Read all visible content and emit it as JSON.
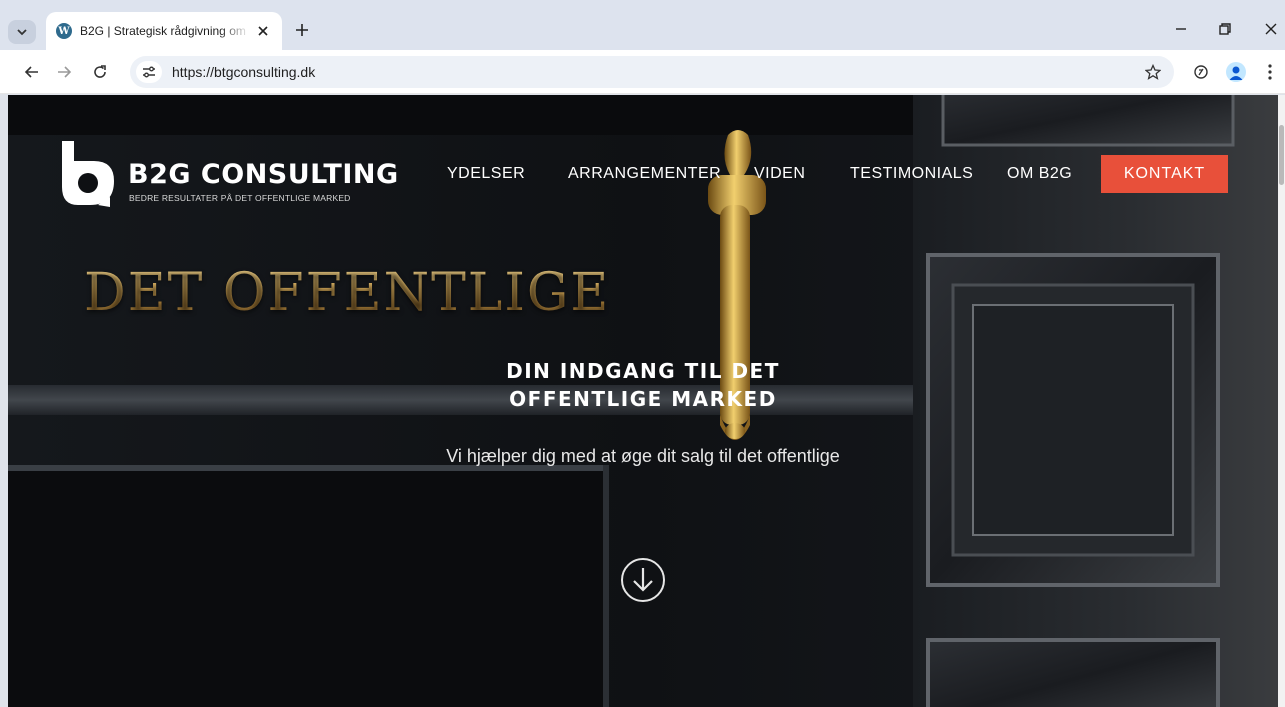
{
  "browser": {
    "tab": {
      "title": "B2G | Strategisk rådgivning om",
      "favicon": "wordpress-icon"
    },
    "address": {
      "url": "https://btgconsulting.dk"
    }
  },
  "site": {
    "logo": {
      "name": "B2G CONSULTING",
      "tagline": "BEDRE RESULTATER PÅ DET OFFENTLIGE MARKED"
    },
    "nav": [
      {
        "label": "YDELSER"
      },
      {
        "label": "ARRANGEMENTER"
      },
      {
        "label": "VIDEN"
      },
      {
        "label": "TESTIMONIALS"
      },
      {
        "label": "OM B2G"
      }
    ],
    "cta": {
      "label": "KONTAKT",
      "color": "#e8503a"
    },
    "hero": {
      "heading": "DET OFFENTLIGE",
      "subheading": "DIN INDGANG TIL DET OFFENTLIGE MARKED",
      "description": "Vi hjælper dig med at øge dit salg til det offentlige",
      "scroll_icon": "arrow-down-circle-icon"
    }
  }
}
